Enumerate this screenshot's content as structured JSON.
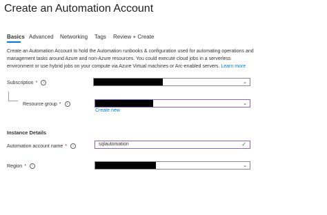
{
  "header": {
    "title": "Create an Automation Account",
    "more_label": "···"
  },
  "tabs": [
    {
      "label": "Basics",
      "active": true
    },
    {
      "label": "Advanced",
      "active": false
    },
    {
      "label": "Networking",
      "active": false
    },
    {
      "label": "Tags",
      "active": false
    },
    {
      "label": "Review + Create",
      "active": false
    }
  ],
  "description": {
    "text": "Create an Automation Account to hold the Automation runbooks & configuration used for automating operations and management tasks around Azure and non-Azure resources. You could execute cloud jobs in a serverless environment or use hybrid jobs on your compute via Azure Virtual machines or Arc-enabled servers.",
    "learn_more": "Learn more"
  },
  "fields": {
    "subscription": {
      "label": "Subscription",
      "required": "*",
      "value": ""
    },
    "resource_group": {
      "label": "Resource group",
      "required": "*",
      "value": "",
      "create_new": "Create new"
    },
    "account_name": {
      "label": "Automation account name",
      "required": "*",
      "value": "sqlautomation"
    },
    "region": {
      "label": "Region",
      "required": "*",
      "value": ""
    }
  },
  "section_instance": "Instance Details",
  "icons": {
    "info": "info-icon",
    "dropdown": "chevron-down-icon",
    "valid": "checkmark-icon"
  },
  "colors": {
    "accent": "#0078d4",
    "required": "#a4262c",
    "focus_border": "#8764b8",
    "valid": "#107c10"
  }
}
